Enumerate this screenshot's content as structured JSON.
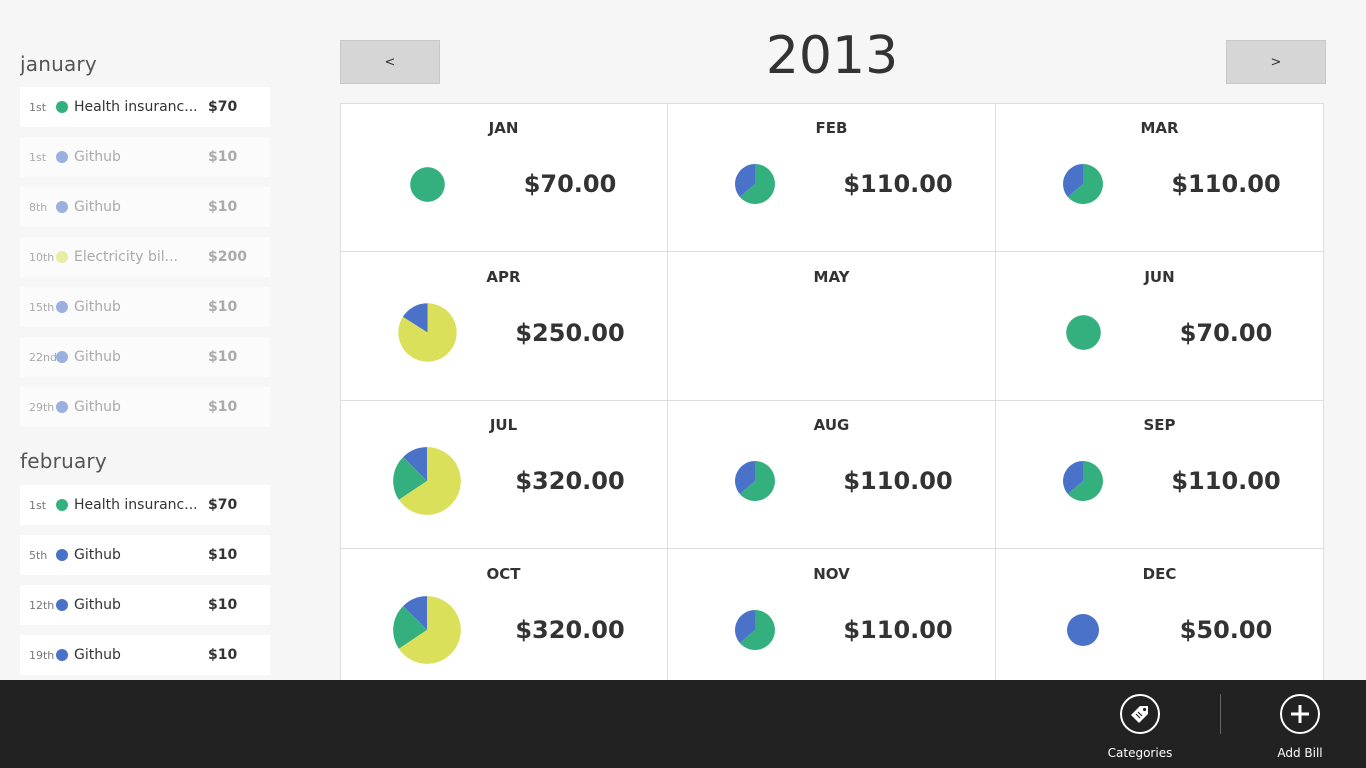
{
  "colors": {
    "health": "#34b07e",
    "github": "#4a72c8",
    "electricity": "#dbe05a"
  },
  "sidebar": {
    "groups": [
      {
        "month": "january",
        "bills": [
          {
            "day": "1st",
            "name": "Health insuranc...",
            "amount": "$70",
            "category": "health",
            "past": false
          },
          {
            "day": "1st",
            "name": "Github",
            "amount": "$10",
            "category": "github",
            "past": true
          },
          {
            "day": "8th",
            "name": "Github",
            "amount": "$10",
            "category": "github",
            "past": true
          },
          {
            "day": "10th",
            "name": "Electricity bil...",
            "amount": "$200",
            "category": "electricity",
            "past": true
          },
          {
            "day": "15th",
            "name": "Github",
            "amount": "$10",
            "category": "github",
            "past": true
          },
          {
            "day": "22nd",
            "name": "Github",
            "amount": "$10",
            "category": "github",
            "past": true
          },
          {
            "day": "29th",
            "name": "Github",
            "amount": "$10",
            "category": "github",
            "past": true
          }
        ]
      },
      {
        "month": "february",
        "bills": [
          {
            "day": "1st",
            "name": "Health insuranc...",
            "amount": "$70",
            "category": "health",
            "past": false
          },
          {
            "day": "5th",
            "name": "Github",
            "amount": "$10",
            "category": "github",
            "past": false
          },
          {
            "day": "12th",
            "name": "Github",
            "amount": "$10",
            "category": "github",
            "past": false
          },
          {
            "day": "19th",
            "name": "Github",
            "amount": "$10",
            "category": "github",
            "past": false
          }
        ]
      }
    ]
  },
  "header": {
    "prev_label": "<",
    "next_label": ">",
    "year": "2013"
  },
  "months": [
    {
      "name": "JAN",
      "total": "$70.00",
      "breakdown": {
        "health": 70
      }
    },
    {
      "name": "FEB",
      "total": "$110.00",
      "breakdown": {
        "health": 70,
        "github": 40
      }
    },
    {
      "name": "MAR",
      "total": "$110.00",
      "breakdown": {
        "health": 70,
        "github": 40
      }
    },
    {
      "name": "APR",
      "total": "$250.00",
      "breakdown": {
        "electricity": 210,
        "github": 40
      }
    },
    {
      "name": "MAY",
      "total": "",
      "breakdown": {}
    },
    {
      "name": "JUN",
      "total": "$70.00",
      "breakdown": {
        "health": 70
      }
    },
    {
      "name": "JUL",
      "total": "$320.00",
      "breakdown": {
        "electricity": 210,
        "health": 70,
        "github": 40
      }
    },
    {
      "name": "AUG",
      "total": "$110.00",
      "breakdown": {
        "health": 70,
        "github": 40
      }
    },
    {
      "name": "SEP",
      "total": "$110.00",
      "breakdown": {
        "health": 70,
        "github": 40
      }
    },
    {
      "name": "OCT",
      "total": "$320.00",
      "breakdown": {
        "electricity": 210,
        "health": 70,
        "github": 40
      }
    },
    {
      "name": "NOV",
      "total": "$110.00",
      "breakdown": {
        "health": 70,
        "github": 40
      }
    },
    {
      "name": "DEC",
      "total": "$50.00",
      "breakdown": {
        "github": 50
      }
    }
  ],
  "appbar": {
    "categories": {
      "label": "Categories",
      "icon": "tag-icon"
    },
    "add_bill": {
      "label": "Add Bill",
      "icon": "plus-icon"
    }
  }
}
